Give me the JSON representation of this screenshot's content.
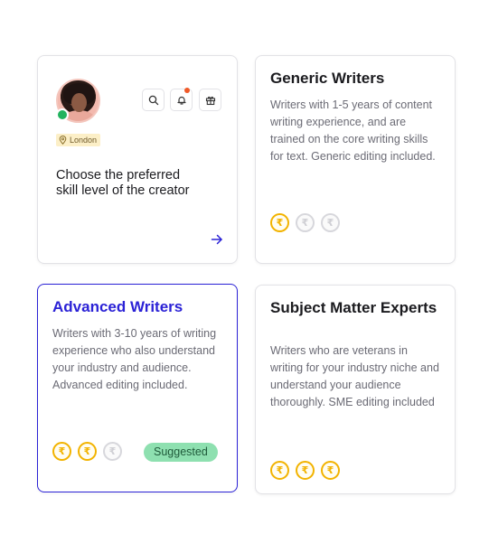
{
  "profile_card": {
    "location": "London",
    "headline": "Choose the preferred skill level of the creator",
    "icons": [
      "search-icon",
      "notification-icon",
      "gift-icon",
      "arrow-right-icon",
      "location-pin-icon"
    ]
  },
  "tiers": [
    {
      "title": "Generic Writers",
      "description": "Writers with 1-5 years of content writing experience, and are trained on the core writing skills for text. Generic editing included.",
      "coins_active": 1,
      "coins_total": 3,
      "selected": false
    },
    {
      "title": "Advanced Writers",
      "description": "Writers with 3-10 years of writing experience who also understand your industry and audience. Advanced editing included.",
      "coins_active": 2,
      "coins_total": 3,
      "selected": true,
      "badge": "Suggested"
    },
    {
      "title": "Subject Matter Experts",
      "description": "Writers who are veterans in writing for your industry niche and understand your audience thoroughly. SME editing included",
      "coins_active": 3,
      "coins_total": 3,
      "selected": false
    }
  ],
  "coin_symbol": "₹",
  "colors": {
    "accent": "#2b22d6",
    "coin_active": "#f2b300",
    "coin_inactive": "#d7d7dc",
    "suggested_bg": "#8ee0b0",
    "online": "#22b35e",
    "notification": "#f05a28"
  }
}
